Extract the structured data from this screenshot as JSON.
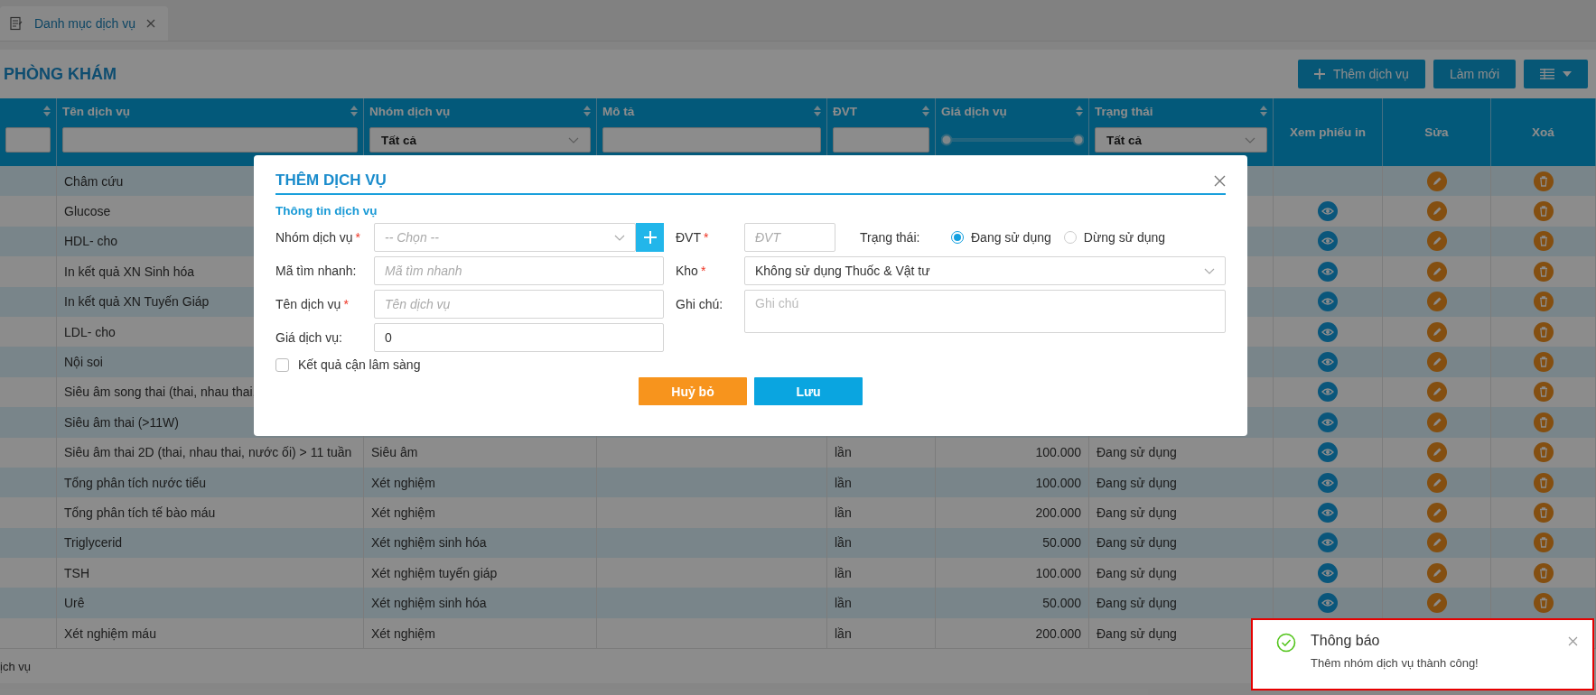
{
  "tab": {
    "label": "Danh mục dịch vụ",
    "selected": true
  },
  "page": {
    "title": "PHÒNG KHÁM",
    "buttons": [
      {
        "kind": "add",
        "label": "Thêm dịch vụ"
      },
      {
        "kind": "plain",
        "label": "Làm mới"
      },
      {
        "kind": "columns"
      }
    ]
  },
  "table": {
    "columns": [
      {
        "sortable": true,
        "kind": "input"
      },
      {
        "label": "Tên dịch vụ",
        "sortable": true,
        "kind": "input"
      },
      {
        "label": "Nhóm dịch vụ",
        "sortable": true,
        "kind": "select",
        "filter_value": "Tất cả"
      },
      {
        "label": "Mô tả",
        "sortable": true,
        "kind": "input"
      },
      {
        "label": "ĐVT",
        "sortable": true,
        "kind": "input"
      },
      {
        "label": "Giá dịch vụ",
        "sortable": true,
        "kind": "range",
        "level": 1
      },
      {
        "label": "Trạng thái",
        "sortable": true,
        "kind": "select",
        "filter_value": "Tất cả"
      },
      {
        "label": "Xem phiếu in",
        "sortable": false,
        "kind": "plain"
      },
      {
        "label": "Sửa",
        "sortable": false,
        "kind": "plain"
      },
      {
        "label": "Xoá",
        "sortable": false,
        "kind": "plain"
      }
    ],
    "rows": [
      {
        "name": "Châm cứu",
        "printable": false
      },
      {
        "name": "Glucose",
        "printable": true
      },
      {
        "name": "HDL- cho",
        "printable": true
      },
      {
        "name": "In kết quả XN Sinh hóa",
        "printable": true
      },
      {
        "name": "In kết quả XN Tuyến Giáp",
        "printable": true
      },
      {
        "name": "LDL- cho",
        "printable": true
      },
      {
        "name": "Nội soi",
        "printable": true
      },
      {
        "name": "Siêu âm song thai (thai, nhau thai,",
        "printable": true
      },
      {
        "name": "Siêu âm thai (>11W)",
        "printable": true
      },
      {
        "name": "Siêu âm thai 2D (thai, nhau thai, nước ối) > 11 tuần",
        "group": "Siêu âm",
        "unit": "lần",
        "price": "100.000",
        "status": "Đang sử dụng",
        "printable": true
      },
      {
        "name": "Tổng phân tích nước tiểu",
        "group": "Xét nghiệm",
        "unit": "lần",
        "price": "100.000",
        "status": "Đang sử dụng",
        "printable": true
      },
      {
        "name": "Tổng phân tích tế bào máu",
        "group": "Xét nghiệm",
        "unit": "lần",
        "price": "200.000",
        "status": "Đang sử dụng",
        "printable": true
      },
      {
        "name": "Triglycerid",
        "group": "Xét nghiệm sinh hóa",
        "unit": "lần",
        "price": "50.000",
        "status": "Đang sử dụng",
        "printable": true
      },
      {
        "name": "TSH",
        "group": "Xét nghiệm tuyến giáp",
        "unit": "lần",
        "price": "100.000",
        "status": "Đang sử dụng",
        "printable": true
      },
      {
        "name": "Urê",
        "group": "Xét nghiệm sinh hóa",
        "unit": "lần",
        "price": "50.000",
        "status": "Đang sử dụng",
        "printable": true
      },
      {
        "name": "Xét nghiệm máu",
        "group": "Xét nghiệm",
        "unit": "lần",
        "price": "200.000",
        "status": "Đang sử dụng"
      }
    ],
    "footer": "ịch vụ"
  },
  "dialog": {
    "title": "THÊM DỊCH VỤ",
    "section": "Thông tin dịch vụ",
    "left_fields": [
      {
        "label": "Nhóm dịch vụ",
        "required_mark": "*",
        "kind": "select",
        "placeholder": "-- Chọn --",
        "add_button": true
      },
      {
        "label": "Mã tìm nhanh:",
        "kind": "text",
        "placeholder": "Mã tìm nhanh"
      },
      {
        "label": "Tên dịch vụ",
        "required_mark": "*",
        "kind": "text",
        "placeholder": "Tên dịch vụ"
      },
      {
        "label": "Giá dịch vụ:",
        "kind": "text",
        "value": "0"
      }
    ],
    "checkbox": {
      "label": "Kết quả cận lâm sàng",
      "checked": false
    },
    "unit_field": {
      "label": "ĐVT",
      "required_mark": "*",
      "placeholder": "ĐVT"
    },
    "status": {
      "label": "Trạng thái:",
      "options": [
        {
          "label": "Đang sử dụng",
          "selected": true
        },
        {
          "label": "Dừng sử dụng",
          "selected": false
        }
      ]
    },
    "store_field": {
      "label": "Kho",
      "required_mark": "*",
      "value": "Không sử dụng Thuốc & Vật tư"
    },
    "note_field": {
      "label": "Ghi chú:",
      "placeholder": "Ghi chú"
    },
    "buttons": [
      {
        "kind": "cancel",
        "label": "Huỷ bỏ"
      },
      {
        "kind": "save",
        "label": "Lưu"
      }
    ]
  },
  "toast": {
    "kind": "success",
    "title": "Thông báo",
    "message": "Thêm nhóm dịch vụ thành công!"
  }
}
